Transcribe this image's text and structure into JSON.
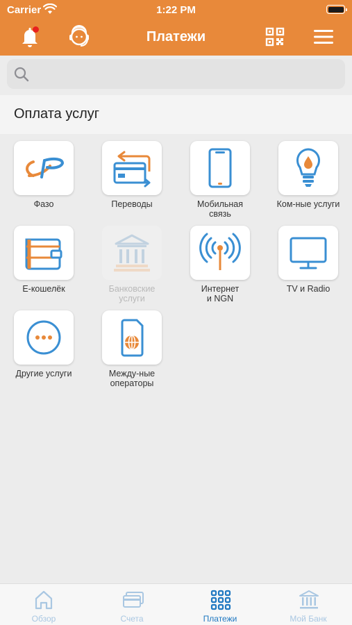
{
  "status": {
    "carrier": "Carrier",
    "time": "1:22 PM"
  },
  "header": {
    "title": "Платежи"
  },
  "search": {
    "placeholder": ""
  },
  "section": {
    "title": "Оплата услуг"
  },
  "services": [
    {
      "label": "Фазо",
      "icon": "fazo-logo-icon",
      "enabled": true
    },
    {
      "label": "Переводы",
      "icon": "transfer-cards-icon",
      "enabled": true
    },
    {
      "label": "Мобильная\nсвязь",
      "icon": "mobile-phone-icon",
      "enabled": true
    },
    {
      "label": "Ком-ные услуги",
      "icon": "lightbulb-drop-icon",
      "enabled": true
    },
    {
      "label": "E-кошелёк",
      "icon": "wallet-icon",
      "enabled": true
    },
    {
      "label": "Банковские\nуслуги",
      "icon": "bank-icon",
      "enabled": false
    },
    {
      "label": "Интернет\nи NGN",
      "icon": "antenna-icon",
      "enabled": true
    },
    {
      "label": "TV и Radio",
      "icon": "tv-icon",
      "enabled": true
    },
    {
      "label": "Другие услуги",
      "icon": "more-dots-icon",
      "enabled": true
    },
    {
      "label": "Между-ные\nоператоры",
      "icon": "sim-card-globe-icon",
      "enabled": true
    }
  ],
  "tabs": [
    {
      "label": "Обзор",
      "icon": "home-icon",
      "active": false
    },
    {
      "label": "Счета",
      "icon": "cards-icon",
      "active": false
    },
    {
      "label": "Платежи",
      "icon": "grid-icon",
      "active": true
    },
    {
      "label": "Мой Банк",
      "icon": "bank-icon",
      "active": false
    }
  ],
  "colors": {
    "brand": "#e8893a",
    "icon_blue": "#3a8fd3",
    "icon_orange": "#e8893a",
    "tab_active": "#1f78c1",
    "tab_inactive": "#a9c7e2",
    "badge": "#e8211e"
  }
}
